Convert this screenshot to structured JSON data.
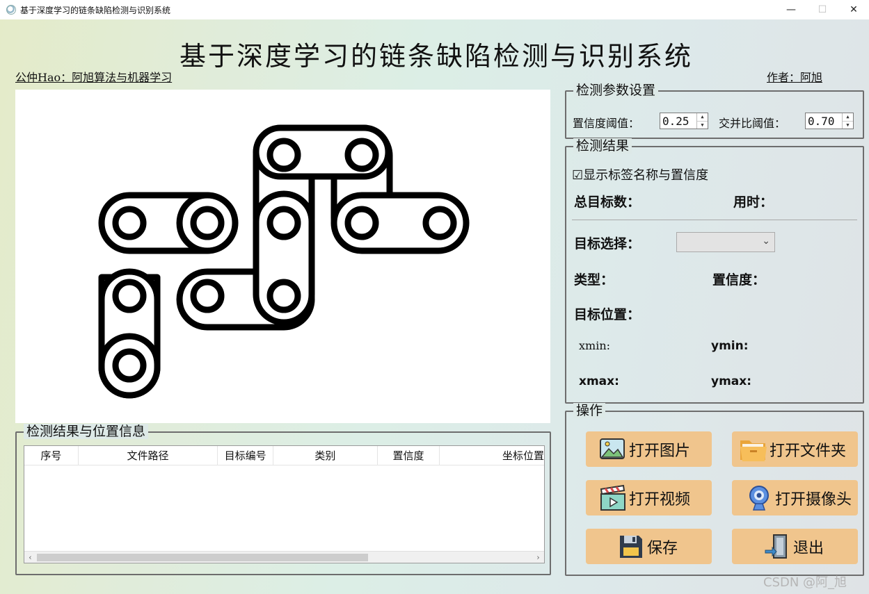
{
  "window": {
    "title": "基于深度学习的链条缺陷检测与识别系统",
    "minimize": "—",
    "maximize": "☐",
    "close": "✕"
  },
  "header": {
    "title": "基于深度学习的链条缺陷检测与识别系统",
    "left_note": "公仲Hao：阿旭算法与机器学习",
    "right_note": "作者：阿旭"
  },
  "params": {
    "legend": "检测参数设置",
    "conf_label": "置信度阈值：",
    "conf_value": "0.25",
    "iou_label": "交并比阈值：",
    "iou_value": "0.70"
  },
  "result": {
    "legend": "检测结果",
    "show_labels_checkbox": "☑显示标签名称与置信度",
    "show_labels_checked": true,
    "total_label": "总目标数：",
    "time_label": "用时：",
    "target_select_label": "目标选择：",
    "target_select_value": "",
    "type_label": "类型：",
    "confidence_label": "置信度：",
    "position_label": "目标位置：",
    "xmin_label": "xmin:",
    "ymin_label": "ymin:",
    "xmax_label": "xmax:",
    "ymax_label": "ymax:"
  },
  "table": {
    "legend": "检测结果与位置信息",
    "columns": [
      "序号",
      "文件路径",
      "目标编号",
      "类别",
      "置信度",
      "坐标位置"
    ],
    "rows": []
  },
  "actions": {
    "legend": "操作",
    "open_image": "打开图片",
    "open_folder": "打开文件夹",
    "open_video": "打开视频",
    "open_camera": "打开摄像头",
    "save": "保存",
    "exit": "退出"
  },
  "watermark": "CSDN @阿_旭"
}
